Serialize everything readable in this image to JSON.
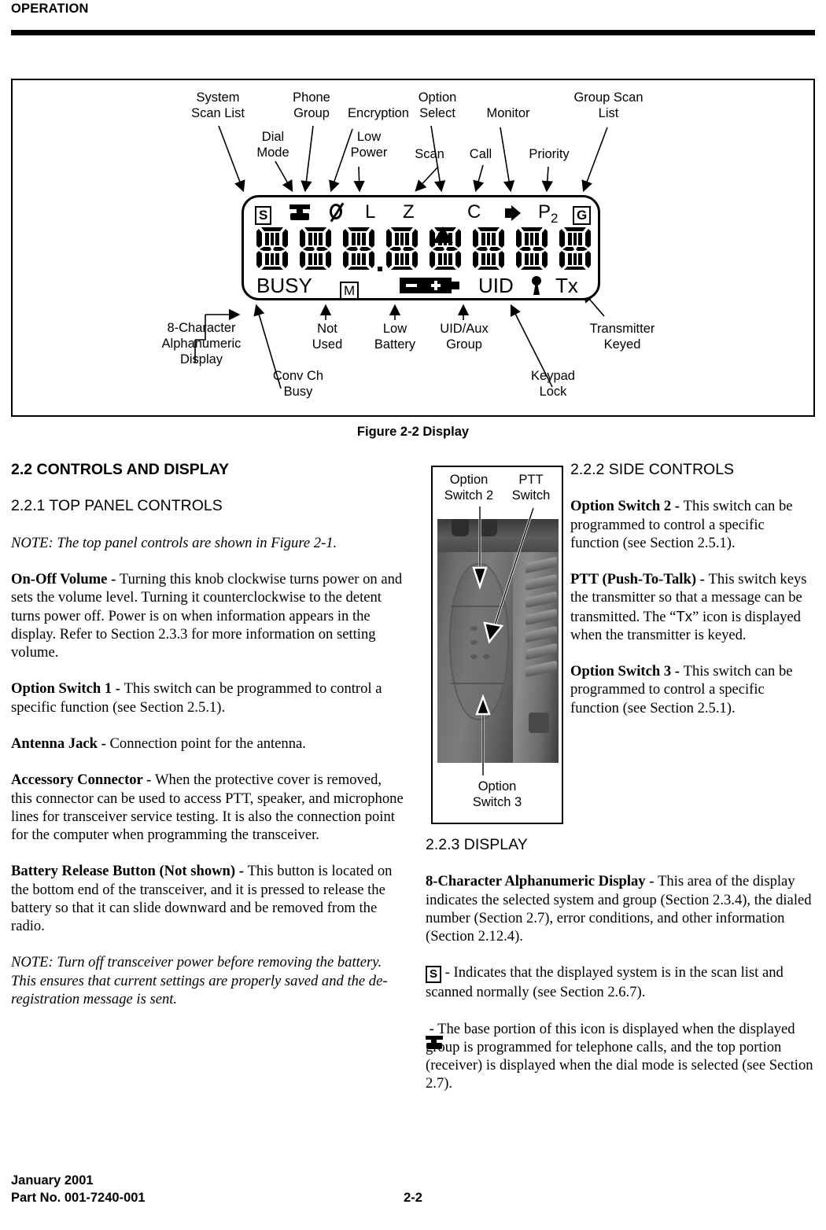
{
  "running_head": "OPERATION",
  "figure": {
    "caption": "Figure 2-2   Display",
    "top_labels": [
      {
        "id": "system-scan-list",
        "text": "System\nScan List"
      },
      {
        "id": "dial-mode",
        "text": "Dial\nMode"
      },
      {
        "id": "phone-group",
        "text": "Phone\nGroup"
      },
      {
        "id": "encryption",
        "text": "Encryption"
      },
      {
        "id": "low-power",
        "text": "Low\nPower"
      },
      {
        "id": "scan",
        "text": "Scan"
      },
      {
        "id": "option-select",
        "text": "Option\nSelect"
      },
      {
        "id": "call",
        "text": "Call"
      },
      {
        "id": "monitor",
        "text": "Monitor"
      },
      {
        "id": "priority",
        "text": "Priority"
      },
      {
        "id": "group-scan-list",
        "text": "Group Scan\nList"
      }
    ],
    "bottom_labels": [
      {
        "id": "alphanumeric-display",
        "text": "8-Character\nAlphanumeric\nDisplay"
      },
      {
        "id": "conv-ch-busy",
        "text": "Conv Ch\nBusy"
      },
      {
        "id": "not-used",
        "text": "Not\nUsed"
      },
      {
        "id": "low-battery",
        "text": "Low\nBattery"
      },
      {
        "id": "uid-aux-group",
        "text": "UID/Aux\nGroup"
      },
      {
        "id": "keypad-lock",
        "text": "Keypad\nLock"
      },
      {
        "id": "transmitter-keyed",
        "text": "Transmitter\nKeyed"
      }
    ],
    "lcd": {
      "icon_row": [
        {
          "name": "system-scan-list-icon",
          "glyph": "S",
          "kind": "boxed-letter"
        },
        {
          "name": "phone-group-icon",
          "glyph": "",
          "kind": "telephone"
        },
        {
          "name": "dial-mode-icon",
          "glyph": "",
          "kind": "slashed-zero"
        },
        {
          "name": "low-power-icon",
          "glyph": "L",
          "kind": "letter"
        },
        {
          "name": "encryption-icon",
          "glyph": "Z",
          "kind": "letter"
        },
        {
          "name": "scan-icon",
          "glyph": "",
          "kind": "triangle"
        },
        {
          "name": "call-icon",
          "glyph": "C",
          "kind": "letter"
        },
        {
          "name": "monitor-icon",
          "glyph": "",
          "kind": "speaker"
        },
        {
          "name": "priority-icon",
          "glyph": "P2",
          "kind": "letter-sub"
        },
        {
          "name": "group-scan-list-icon",
          "glyph": "G",
          "kind": "boxed-letter"
        }
      ],
      "character_count": 8,
      "bottom_row": [
        {
          "name": "conv-ch-busy-indicator",
          "glyph": "BUSY",
          "kind": "text"
        },
        {
          "name": "not-used-indicator",
          "glyph": "M",
          "kind": "boxed-letter"
        },
        {
          "name": "low-battery-icon",
          "glyph": "",
          "kind": "battery"
        },
        {
          "name": "uid-aux-group-indicator",
          "glyph": "UID",
          "kind": "text"
        },
        {
          "name": "keypad-lock-icon",
          "glyph": "",
          "kind": "lock"
        },
        {
          "name": "transmitter-keyed-indicator",
          "glyph": "Tx",
          "kind": "text"
        }
      ]
    }
  },
  "photo_box": {
    "label_option_switch_2": "Option\nSwitch 2",
    "label_ptt_switch": "PTT\nSwitch",
    "label_option_switch_3": "Option\nSwitch 3"
  },
  "left_column": {
    "section_22_heading": "2.2 CONTROLS AND DISPLAY",
    "section_221_heading": "2.2.1 TOP PANEL CONTROLS",
    "note_1": "NOTE: The top panel controls are shown in Figure 2-1.",
    "on_off_volume_term": "On-Off Volume - ",
    "on_off_volume_body": "Turning this knob clockwise turns power on and sets the volume level. Turning it counterclockwise to the detent turns power off. Power is on when information appears in the display. Refer to Section 2.3.3 for more information on setting volume.",
    "option_switch_1_term": "Option Switch 1 - ",
    "option_switch_1_body": "This switch can be programmed to control a specific function (see Section 2.5.1).",
    "antenna_jack_term": "Antenna Jack - ",
    "antenna_jack_body": "Connection point for the antenna.",
    "accessory_connector_term": "Accessory Connector - ",
    "accessory_connector_body": "When the protective cover is removed, this connector can be used to access PTT, speaker, and microphone lines for transceiver service testing. It is also the connection point for the computer when programming the transceiver.",
    "battery_release_term": "Battery Release Button (Not shown) - ",
    "battery_release_body": "This button is located on the bottom end of the transceiver, and it is pressed to release the battery so that it can slide downward and be removed from the radio.",
    "note_2": "NOTE: Turn off transceiver power before removing the battery. This ensures that current settings are properly saved and the de-registration message is sent."
  },
  "right_column": {
    "section_222_heading": "2.2.2 SIDE CONTROLS",
    "option_switch_2_term": "Option Switch 2 - ",
    "option_switch_2_body": "This switch can be programmed to control a specific function (see Section 2.5.1).",
    "ptt_term": "PTT (Push-To-Talk) - ",
    "ptt_body_1": "This switch keys the transmitter so that a message can be transmitted. The “",
    "ptt_tx_icon": "Tx",
    "ptt_body_2": "” icon is displayed when the transmitter is keyed.",
    "option_switch_3_term": "Option Switch 3 - ",
    "option_switch_3_body": "This switch can be programmed to control a specific function (see Section 2.5.1).",
    "section_223_heading": "2.2.3 DISPLAY",
    "alphanumeric_term": "8-Character Alphanumeric Display - ",
    "alphanumeric_body": "This area of the display indicates the selected system and group (Section 2.3.4), the dialed number (Section 2.7), error conditions, and other information (Section 2.12.4).",
    "s_icon_glyph": "S",
    "s_icon_body": " - Indicates that the displayed system is in the scan list and scanned normally (see Section 2.6.7).",
    "phone_icon_body": " - The base portion of this icon is displayed when the displayed group is programmed for telephone calls, and the top portion (receiver) is displayed when the dial mode is selected (see Section 2.7)."
  },
  "footer": {
    "date": "January 2001",
    "part_no": "Part No. 001-7240-001",
    "page_no": "2-2"
  }
}
